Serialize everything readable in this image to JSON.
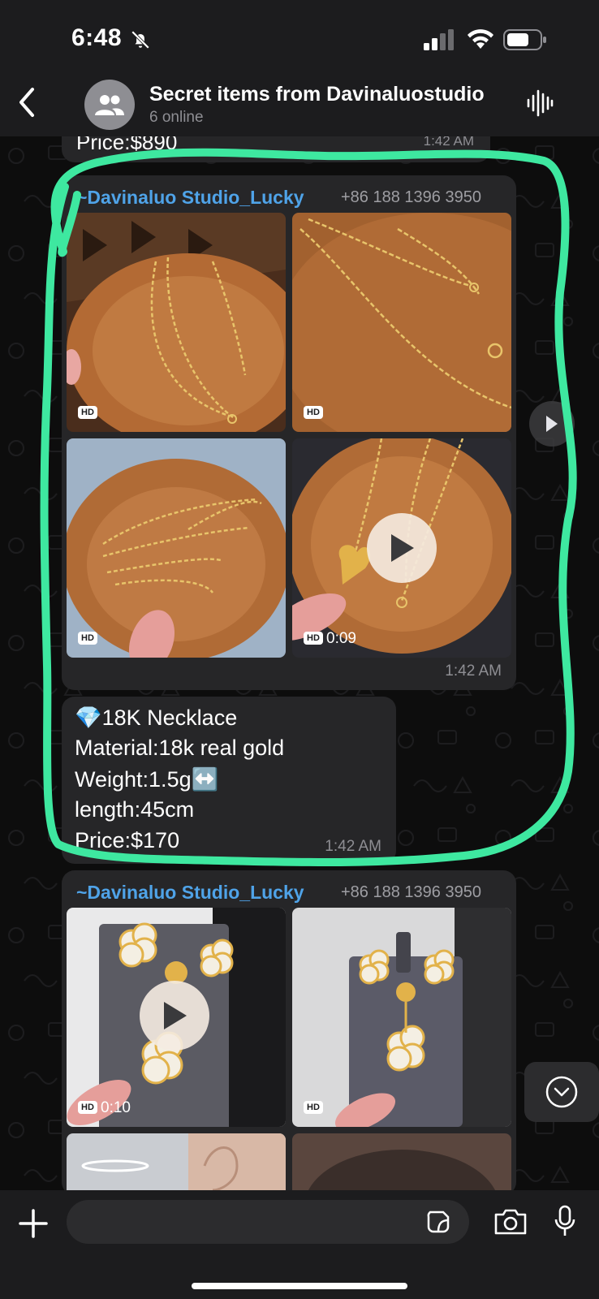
{
  "status_bar": {
    "time": "6:48",
    "icons": [
      "bell-slash-icon",
      "cellular-signal-icon",
      "wifi-icon",
      "battery-icon"
    ]
  },
  "header": {
    "title": "Secret items from Davinaluostudio",
    "subtitle": "6 online",
    "icons": [
      "back-chevron-icon",
      "group-avatar-icon",
      "waveform-icon"
    ]
  },
  "messages": {
    "prev": {
      "text": "Price:$890",
      "time": "1:42 AM"
    },
    "album1": {
      "sender": "~Davinaluo Studio_Lucky",
      "phone": "+86 188 1396 3950",
      "items": [
        {
          "type": "photo",
          "badge": "HD"
        },
        {
          "type": "photo",
          "badge": "HD"
        },
        {
          "type": "photo",
          "badge": "HD"
        },
        {
          "type": "video",
          "badge": "HD",
          "duration": "0:09"
        }
      ],
      "time": "1:42 AM"
    },
    "caption": {
      "emoji": "💎",
      "title": "18K Necklace",
      "material": "Material:18k real gold",
      "weight": "Weight:1.5g",
      "weight_emoji": "↔️",
      "length": "length:45cm",
      "price": "Price:$170",
      "time": "1:42 AM"
    },
    "album2": {
      "sender": "~Davinaluo Studio_Lucky",
      "phone": "+86 188 1396 3950",
      "items": [
        {
          "type": "video",
          "badge": "HD",
          "duration": "0:10"
        },
        {
          "type": "photo",
          "badge": "HD"
        }
      ]
    }
  },
  "colors": {
    "accent_sender": "#4fa3e8",
    "highlight": "#3ee8a0",
    "bubble": "#262628"
  }
}
